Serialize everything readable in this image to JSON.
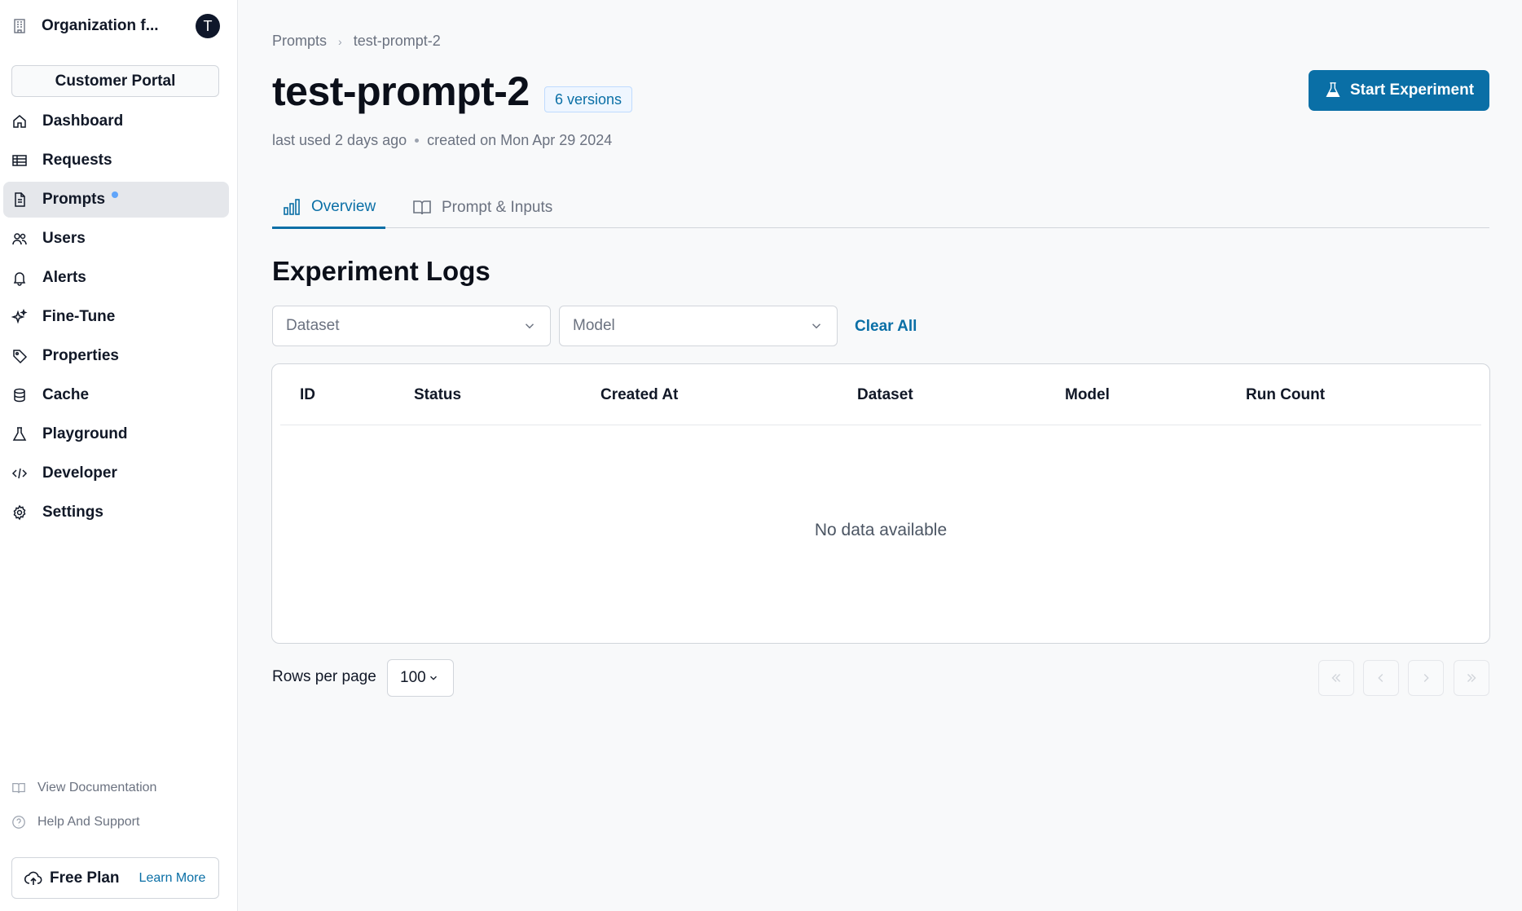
{
  "sidebar": {
    "org_name": "Organization f...",
    "avatar_initial": "T",
    "portal_label": "Customer Portal",
    "items": [
      {
        "label": "Dashboard",
        "icon": "home-icon"
      },
      {
        "label": "Requests",
        "icon": "table-icon"
      },
      {
        "label": "Prompts",
        "icon": "document-icon",
        "active": true
      },
      {
        "label": "Users",
        "icon": "users-icon"
      },
      {
        "label": "Alerts",
        "icon": "bell-icon"
      },
      {
        "label": "Fine-Tune",
        "icon": "sparkles-icon"
      },
      {
        "label": "Properties",
        "icon": "tag-icon"
      },
      {
        "label": "Cache",
        "icon": "database-icon"
      },
      {
        "label": "Playground",
        "icon": "beaker-icon"
      },
      {
        "label": "Developer",
        "icon": "code-icon"
      },
      {
        "label": "Settings",
        "icon": "gear-icon"
      }
    ],
    "view_docs": "View Documentation",
    "help": "Help And Support",
    "plan_name": "Free Plan",
    "learn_more": "Learn More"
  },
  "breadcrumb": {
    "root": "Prompts",
    "current": "test-prompt-2"
  },
  "header": {
    "title": "test-prompt-2",
    "versions": "6 versions",
    "last_used": "last used 2 days ago",
    "created": "created on Mon Apr 29 2024",
    "start_button": "Start Experiment"
  },
  "tabs": [
    {
      "label": "Overview",
      "active": true
    },
    {
      "label": "Prompt & Inputs",
      "active": false
    }
  ],
  "experiments": {
    "title": "Experiment Logs",
    "dataset_placeholder": "Dataset",
    "model_placeholder": "Model",
    "clear_all": "Clear All",
    "columns": [
      "ID",
      "Status",
      "Created At",
      "Dataset",
      "Model",
      "Run Count"
    ],
    "empty_text": "No data available"
  },
  "pagination": {
    "rows_label": "Rows per page",
    "rows_value": "100"
  },
  "colors": {
    "accent": "#0a6fa6",
    "active_nav_bg": "#e5e7eb",
    "notification_dot": "#60a5fa"
  }
}
